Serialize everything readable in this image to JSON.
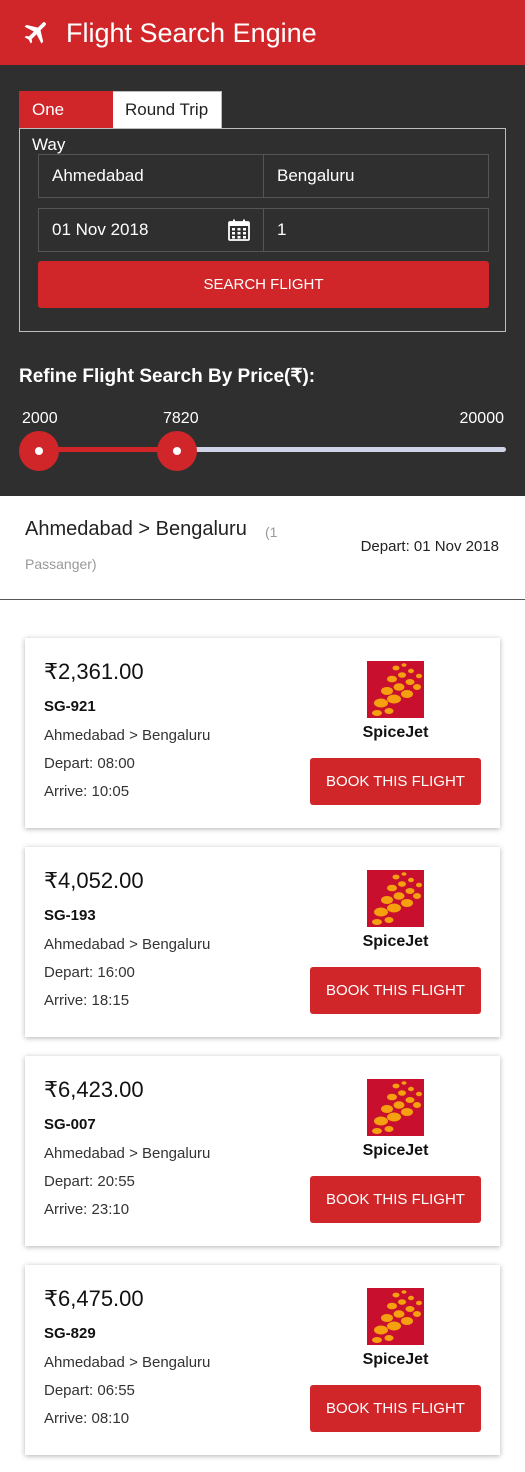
{
  "header": {
    "title": "Flight Search Engine",
    "icon": "airplane-icon"
  },
  "search": {
    "tabs": [
      {
        "label": "One Way",
        "active": true
      },
      {
        "label": "Round Trip",
        "active": false
      }
    ],
    "from": "Ahmedabad",
    "to": "Bengaluru",
    "date": "01 Nov 2018",
    "passengers": "1",
    "button": "SEARCH FLIGHT"
  },
  "refine": {
    "title": "Refine Flight Search By Price(₹):",
    "min": "2000",
    "current": "7820",
    "max": "20000",
    "fill_fraction": 0.321
  },
  "summary": {
    "route": "Ahmedabad > Bengaluru",
    "pax_a": "(1",
    "pax_b": "Passanger)",
    "depart": "Depart: 01 Nov 2018"
  },
  "flights": [
    {
      "price": "₹2,361.00",
      "code": "SG-921",
      "route": "Ahmedabad > Bengaluru",
      "depart": "Depart: 08:00",
      "arrive": "Arrive: 10:05",
      "airline": "SpiceJet",
      "button": "BOOK THIS FLIGHT"
    },
    {
      "price": "₹4,052.00",
      "code": "SG-193",
      "route": "Ahmedabad > Bengaluru",
      "depart": "Depart: 16:00",
      "arrive": "Arrive: 18:15",
      "airline": "SpiceJet",
      "button": "BOOK THIS FLIGHT"
    },
    {
      "price": "₹6,423.00",
      "code": "SG-007",
      "route": "Ahmedabad > Bengaluru",
      "depart": "Depart: 20:55",
      "arrive": "Arrive: 23:10",
      "airline": "SpiceJet",
      "button": "BOOK THIS FLIGHT"
    },
    {
      "price": "₹6,475.00",
      "code": "SG-829",
      "route": "Ahmedabad > Bengaluru",
      "depart": "Depart: 06:55",
      "arrive": "Arrive: 08:10",
      "airline": "SpiceJet",
      "button": "BOOK THIS FLIGHT"
    }
  ],
  "colors": {
    "accent": "#d0262a",
    "panel": "#2f2f2f",
    "track": "#cfd3e6"
  }
}
